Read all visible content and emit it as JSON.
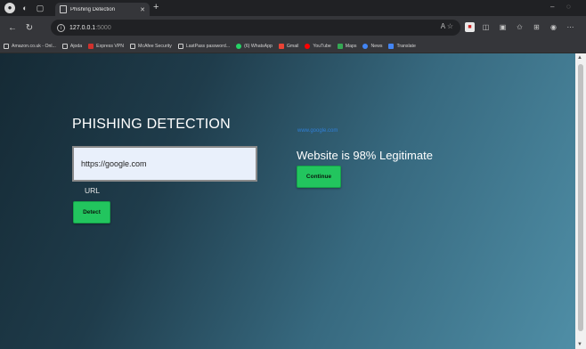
{
  "browser": {
    "tab_title": "Phishing Detection",
    "url_host": "127.0.0.1",
    "url_port": ":5000",
    "bookmarks": [
      {
        "label": "Amazon.co.uk - Onl...",
        "color": "page"
      },
      {
        "label": "Ajoda",
        "color": "page"
      },
      {
        "label": "Express VPN",
        "color": "#d0312d"
      },
      {
        "label": "McAfee Security",
        "color": "page"
      },
      {
        "label": "LastPass password...",
        "color": "page"
      },
      {
        "label": "(6) WhatsApp",
        "color": "#25d366"
      },
      {
        "label": "Gmail",
        "color": "#ea4335"
      },
      {
        "label": "YouTube",
        "color": "#ff0000"
      },
      {
        "label": "Maps",
        "color": "#34a853"
      },
      {
        "label": "News",
        "color": "#4285f4"
      },
      {
        "label": "Translate",
        "color": "#4285f4"
      }
    ]
  },
  "page": {
    "heading": "PHISHING DETECTION",
    "url_input_value": "https://google.com",
    "url_label": "URL",
    "detect_label": "Detect",
    "result_link": "www.google.com",
    "result_text": "Website is 98% Legitimate",
    "continue_label": "Continue"
  },
  "colors": {
    "button_green": "#22c55e",
    "link_blue": "#2f7fd8"
  }
}
